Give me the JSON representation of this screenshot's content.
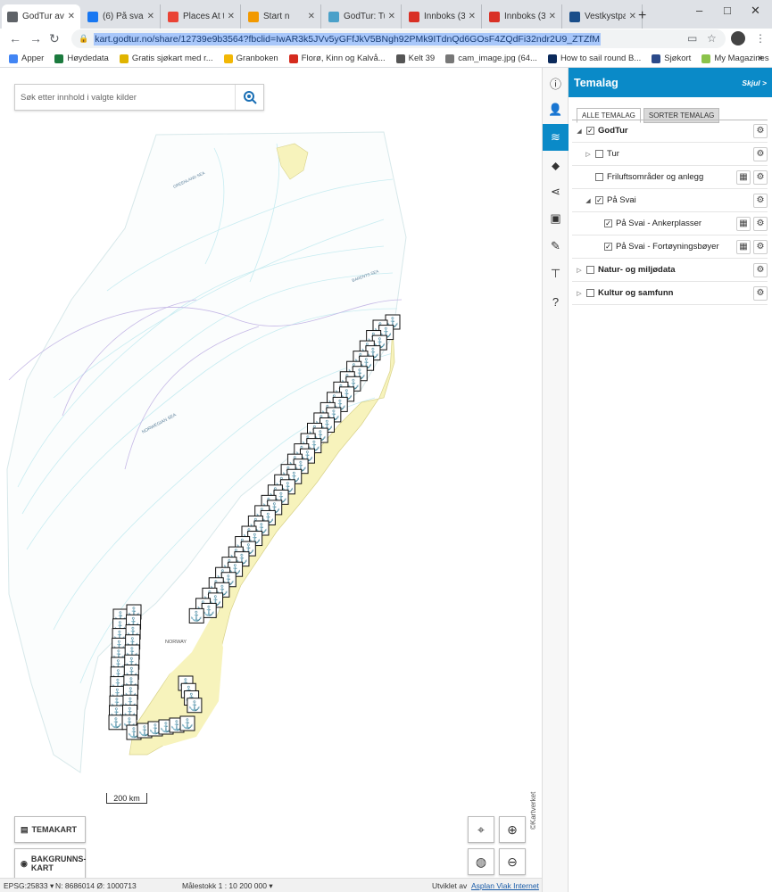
{
  "browser": {
    "tabs": [
      {
        "title": "GodTur ava",
        "color": "#5f6368",
        "active": true
      },
      {
        "title": "(6) På svai",
        "color": "#1877f2"
      },
      {
        "title": "Places At th",
        "color": "#ea4335"
      },
      {
        "title": "Start n",
        "color": "#f29900"
      },
      {
        "title": "GodTur: Tu",
        "color": "#4aa0c9"
      },
      {
        "title": "Innboks (3",
        "color": "#d93025"
      },
      {
        "title": "Innboks (3",
        "color": "#d93025"
      },
      {
        "title": "Vestkystpa",
        "color": "#1a4e8a"
      }
    ],
    "new_tab": "+",
    "window_controls": {
      "minimize": "–",
      "maximize": "□",
      "close": "✕"
    },
    "url": "kart.godtur.no/share/12739e9b3564?fbclid=IwAR3k5JVv5yGFfJkV5BNgh92PMk9ITdnQd6GOsF4ZQdFi32ndr2U9_ZTZfM",
    "bookmarks": [
      {
        "label": "Apper",
        "color": "#4285f4"
      },
      {
        "label": "Høydedata",
        "color": "#1b7a3e"
      },
      {
        "label": "Gratis sjøkart med r...",
        "color": "#e0b400"
      },
      {
        "label": "Granboken",
        "color": "#f2b705"
      },
      {
        "label": "Florø, Kinn og Kalvå...",
        "color": "#d52b1e"
      },
      {
        "label": "Kelt 39",
        "color": "#555555"
      },
      {
        "label": "cam_image.jpg (64...",
        "color": "#777777"
      },
      {
        "label": "How to sail round B...",
        "color": "#0b2a5b"
      },
      {
        "label": "Sjøkort",
        "color": "#2b4a8a"
      },
      {
        "label": "My Magazines",
        "color": "#8bc34a"
      }
    ],
    "bookmarks_more": "»"
  },
  "map": {
    "search_placeholder": "Søk etter innhold i valgte kilder",
    "labels": {
      "norway": "NORWAY",
      "norwegian_sea": "NORWEGIAN SEA",
      "barents_sea": "BARENTS SEA",
      "greenland_sea": "GREENLAND SEA"
    },
    "temakart_label": "TEMAKART",
    "bakgrunnskart_label": "BAKGRUNNS-\nKART",
    "scale_label": "200 km",
    "credit": "©Kartverket"
  },
  "status": {
    "epsg": "EPSG:25833 ▾",
    "coords": "N: 8686014 Ø: 1000713",
    "scale": "Målestokk 1 : 10 200 000 ▾",
    "developer_prefix": "Utviklet av",
    "developer_link": "Asplan Viak Internet"
  },
  "panel": {
    "title": "Temalag",
    "hide_label": "Skjul >",
    "tabs": [
      "ALLE TEMALAG",
      "SORTER TEMALAG"
    ],
    "layers": [
      {
        "label": "GodTur",
        "level": 0,
        "expanded": true,
        "checked": true,
        "bold": true,
        "table": false
      },
      {
        "label": "Tur",
        "level": 1,
        "expanded": false,
        "checked": false,
        "bold": false,
        "table": false
      },
      {
        "label": "Friluftsområder og anlegg",
        "level": 1,
        "expanded": null,
        "checked": false,
        "bold": false,
        "table": true
      },
      {
        "label": "På Svai",
        "level": 1,
        "expanded": true,
        "checked": true,
        "bold": false,
        "table": false
      },
      {
        "label": "På Svai - Ankerplasser",
        "level": 2,
        "expanded": null,
        "checked": true,
        "bold": false,
        "table": true
      },
      {
        "label": "På Svai - Fortøyningsbøyer",
        "level": 2,
        "expanded": null,
        "checked": true,
        "bold": false,
        "table": true
      },
      {
        "label": "Natur- og miljødata",
        "level": 0,
        "expanded": false,
        "checked": false,
        "bold": true,
        "table": false
      },
      {
        "label": "Kultur og samfunn",
        "level": 0,
        "expanded": false,
        "checked": false,
        "bold": true,
        "table": false
      }
    ]
  },
  "rail": [
    "info-icon",
    "user-icon",
    "layers-icon",
    "tag-icon",
    "share-icon",
    "briefcase-icon",
    "pencil-icon",
    "signpost-icon",
    "help-icon"
  ],
  "colors": {
    "accent": "#0a8ac8",
    "land": "#f7f3bc",
    "sea_lines": "#bfe8ee"
  }
}
